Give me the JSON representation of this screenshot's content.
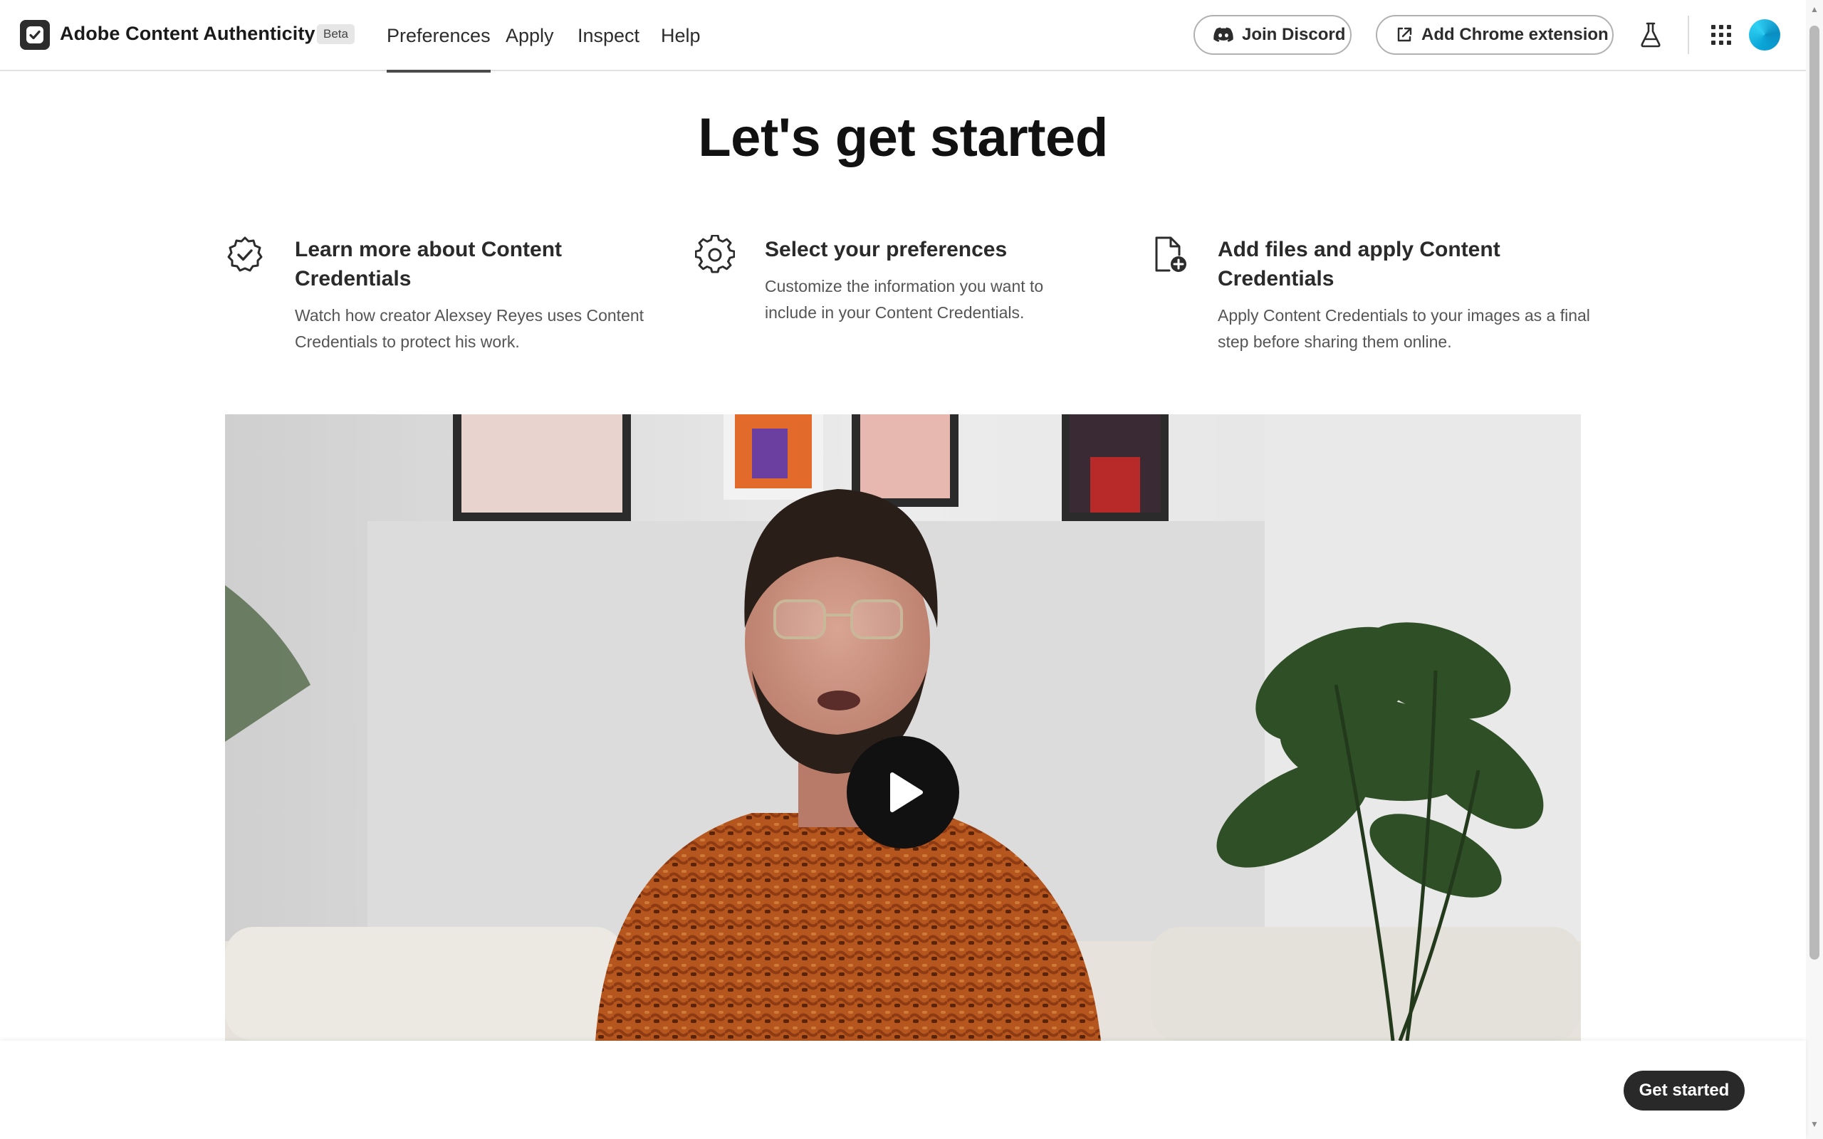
{
  "header": {
    "app_name": "Adobe Content Authenticity",
    "badge": "Beta",
    "logo_icon": "checkmark-shield-icon",
    "nav": [
      {
        "label": "Preferences",
        "active": true
      },
      {
        "label": "Apply",
        "active": false
      },
      {
        "label": "Inspect",
        "active": false
      },
      {
        "label": "Help",
        "active": false
      }
    ],
    "discord_label": "Join Discord",
    "chrome_label": "Add Chrome extension",
    "icons": [
      "discord-icon",
      "external-link-icon",
      "flask-icon",
      "app-grid-icon",
      "avatar"
    ]
  },
  "main": {
    "title": "Let's get started",
    "steps": [
      {
        "icon": "verified-badge-icon",
        "title": "Learn more about Content Credentials",
        "desc": "Watch how creator Alexsey Reyes uses Content Credentials to protect his work."
      },
      {
        "icon": "gear-icon",
        "title": "Select your preferences",
        "desc": "Customize the information you want to include in your Content Credentials."
      },
      {
        "icon": "file-add-icon",
        "title": "Add files and apply Content Credentials",
        "desc": "Apply Content Credentials to your images as a final step before sharing them online."
      }
    ],
    "video": {
      "play_icon": "play-icon"
    }
  },
  "footer": {
    "cta_label": "Get started"
  },
  "colors": {
    "text": "#2c2c2c",
    "button_dark": "#292929",
    "avatar": "#0aa6d8"
  }
}
